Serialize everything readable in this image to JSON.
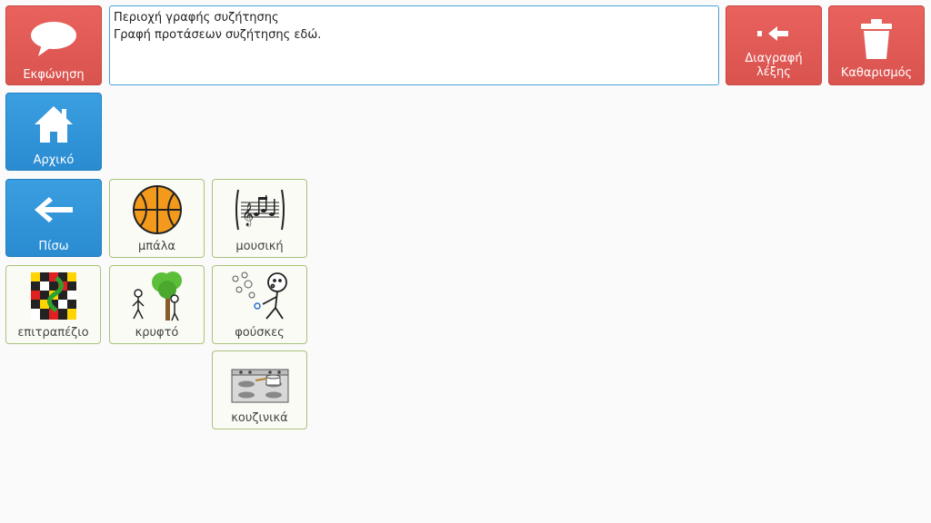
{
  "toolbar": {
    "speak_label": "Εκφώνηση",
    "delete_word_label": "Διαγραφή λέξης",
    "clear_label": "Καθαρισμός"
  },
  "textarea": {
    "title": "Περιοχή γραφής συζήτησης",
    "placeholder": "Γραφή προτάσεων συζήτησης εδώ."
  },
  "nav": {
    "home_label": "Αρχικό",
    "back_label": "Πίσω"
  },
  "symbols": {
    "ball": "μπάλα",
    "music": "μουσική",
    "board_game": "επιτραπέζιο",
    "hide": "κρυφτό",
    "bubbles": "φούσκες",
    "kitchen": "κουζινικά"
  },
  "colors": {
    "action_red": "#d9534f",
    "nav_blue": "#2a8bd1",
    "symbol_border": "#a9c27b",
    "textarea_border": "#4aa2d6"
  },
  "icons": {
    "speak": "speech-bubble-icon",
    "delete_word": "backspace-arrow-icon",
    "clear": "trash-icon",
    "home": "house-icon",
    "back": "left-arrow-icon"
  }
}
